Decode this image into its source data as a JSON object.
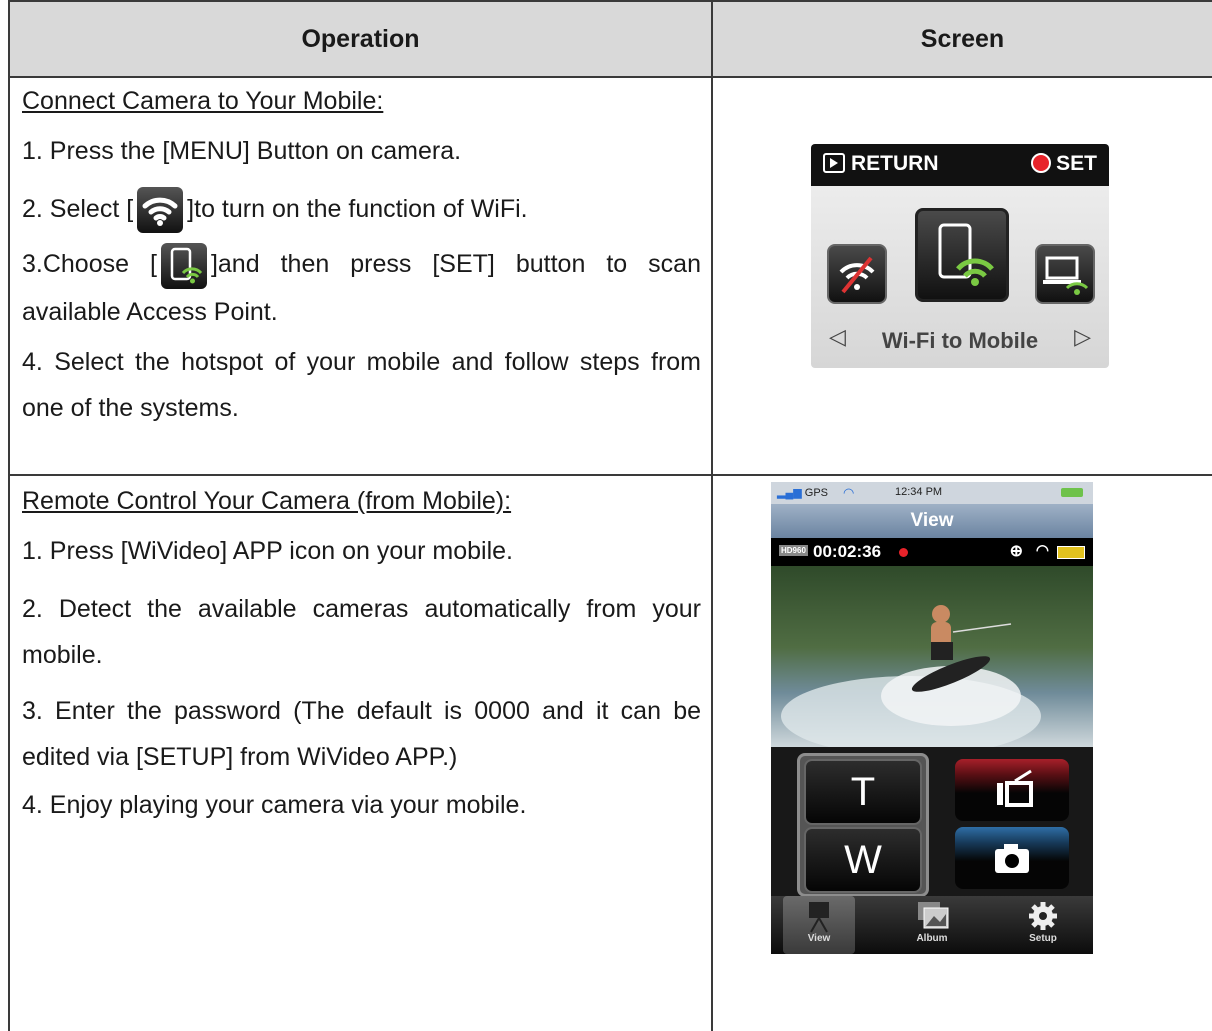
{
  "table": {
    "headers": {
      "operation": "Operation",
      "screen": "Screen"
    },
    "section1": {
      "heading": "Connect Camera to Your Mobile:",
      "step1": "1. Press the [MENU] Button on camera.",
      "step2_pre": "2. Select [",
      "step2_post": "]to turn on the function of WiFi.",
      "step3_pre": "3.Choose [",
      "step3_post": "]and then press [SET] button to scan available  Access Point.",
      "step4": "4. Select the hotspot of your mobile and follow steps from one of the systems.",
      "camera_screen": {
        "return_label": "RETURN",
        "set_label": "SET",
        "mode_label": "Wi-Fi to Mobile",
        "left_arrow": "◁",
        "right_arrow": "▷"
      }
    },
    "section2": {
      "heading": "Remote Control Your Camera (from Mobile):",
      "step1": "1. Press [WiVideo] APP icon on your mobile.",
      "step2": "2. Detect the available cameras automatically from your mobile.",
      "step3": "3. Enter the password (The default is 0000 and it can be edited via [SETUP] from WiVideo APP.)",
      "step4": "4. Enjoy playing your camera via your mobile.",
      "phone_screen": {
        "status_signal": "GPS",
        "status_time": "12:34 PM",
        "nav_title": "View",
        "resolution_badge": "HD960",
        "record_time": "00:02:36",
        "tele_label": "T",
        "wide_label": "W",
        "tabs": [
          "View",
          "Album",
          "Setup"
        ]
      }
    }
  },
  "colors": {
    "header_bg": "#d9d9d9",
    "border": "#3a3a3a",
    "record_red": "#e8232a",
    "wifi_green": "#7ac943",
    "video_btn": "#a8202a",
    "photo_btn": "#2f6ea6"
  }
}
